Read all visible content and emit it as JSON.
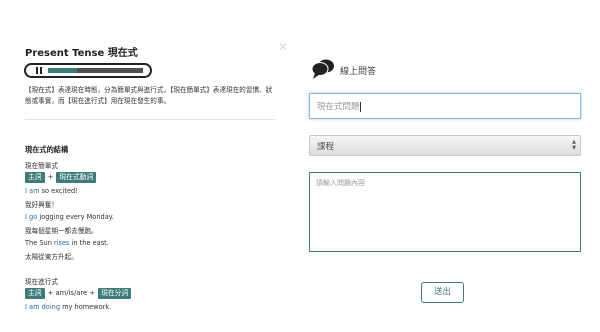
{
  "lesson": {
    "title": "Present Tense 現在式",
    "audio_progress": 0.3,
    "intro": "【現在式】表達現在時態，分為簡單式與進行式，【現在簡單式】表達現在的習慣、狀態或事實，而【現在進行式】用在現在發生的事。"
  },
  "structure": {
    "heading": "現在式的結構",
    "simple": {
      "label": "現在簡單式",
      "chip_subject": "主詞",
      "plus": "+",
      "chip_verb": "現在式動詞",
      "examples": [
        {
          "pre": "",
          "hl": "I am",
          "post": " so excited!",
          "zh": "我好興奮！"
        },
        {
          "pre": "",
          "hl": "I go",
          "post": " jogging every Monday.",
          "zh": "我每個星期一都去慢跑。"
        },
        {
          "pre": "The Sun ",
          "hl": "rises",
          "post": " in the east.",
          "zh": "太陽從東方升起。"
        }
      ]
    },
    "progressive": {
      "label": "現在進行式",
      "chip_subject": "主詞",
      "middle": "+ am/is/are +",
      "chip_participle": "現在分詞",
      "example_hl": "I am doing",
      "example_post": " my homework."
    }
  },
  "qa": {
    "title": "線上問答",
    "subject_value": "現在式問題",
    "course_select": "課程",
    "message_placeholder": "請輸入問題內容",
    "send_label": "送出"
  },
  "colors": {
    "accent_teal": "#3d7c78",
    "example_blue": "#2a67a6"
  }
}
